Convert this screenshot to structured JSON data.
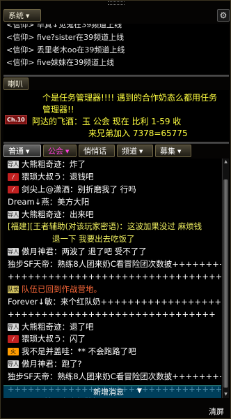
{
  "header": {
    "system_tab": "系统",
    "gear_icon": "gear-icon",
    "horn_tab": "喇叭"
  },
  "system_messages": [
    "<信仰>  毕真↓见鬼在39频道上线",
    "<信仰>  five?sister在39频道上线",
    "<信仰>  丢里老木oo在39频道上线",
    "<信仰>  five妹妹在39频道上线"
  ],
  "horn": {
    "line1": "个是任务管理器!!!!  遇到的合作奶态么都用任务",
    "line2": "管理器!!",
    "channel_badge": "Ch.10",
    "sender": "阿达的飞酒：玉   公会 现在   比利  1-59   收",
    "line4": "来兄弟加入    7378=65775"
  },
  "chat_tabs": [
    {
      "label": "普通",
      "color": "#ffffff"
    },
    {
      "label": "公会",
      "color": "#ff3fdc"
    },
    {
      "label": "悄悄话",
      "color": "#ffffff"
    },
    {
      "label": "频道",
      "color": "#ffffff"
    },
    {
      "label": "募集",
      "color": "#ffffff"
    }
  ],
  "chat_messages": [
    {
      "badge": "square",
      "badge_text": "导人",
      "text": "大熊粗奇迹：炸了",
      "color": "#ffffff"
    },
    {
      "badge": "slash",
      "badge_text": "/",
      "text": "猥琐大叔う：退钱吧",
      "color": "#ffffff"
    },
    {
      "badge": "slash",
      "badge_text": "/",
      "text": "剑尖上@潇洒：别折磨我了   行吗",
      "color": "#ffffff"
    },
    {
      "badge": "",
      "badge_text": "",
      "text": "Dream↓燕：美方大阳",
      "color": "#ffffff"
    },
    {
      "badge": "square",
      "badge_text": "导人",
      "text": "大熊粗奇迹：出来吧",
      "color": "#ffffff"
    },
    {
      "badge": "",
      "badge_text": "",
      "text": "[福建][王者辅助(对该玩家密语)：这波加果没过 麻烦钱",
      "color": "#f0f060"
    },
    {
      "badge": "",
      "badge_text": "",
      "text": "退一下 我要出去吃饭了",
      "color": "#f0f060",
      "indent": true
    },
    {
      "badge": "square",
      "badge_text": "导人",
      "text": "傲月神君：两波了   退了吧   受不了了",
      "color": "#ffffff"
    },
    {
      "badge": "",
      "badge_text": "",
      "text": "独步SF天帝：熟练8人团来奶C看冒险团次数披+++++++++",
      "color": "#ffffff"
    },
    {
      "badge": "",
      "badge_text": "",
      "text": "++++++++++++++++++++++++++++++++7=1来奶",
      "color": "#ffffff"
    },
    {
      "badge": "lead",
      "badge_text": "队长",
      "text": "队伍已回到作战营地。",
      "color": "#ff6a3a"
    },
    {
      "badge": "",
      "badge_text": "",
      "text": "Forever↓敏：来个红队奶++++++++++++++++++++++++",
      "color": "#ffffff"
    },
    {
      "badge": "",
      "badge_text": "",
      "text": "+++++++++++++++++++++++++++++++",
      "color": "#ffffff"
    },
    {
      "badge": "square",
      "badge_text": "导人",
      "text": "大熊粗奇迹：退了吧",
      "color": "#ffffff"
    },
    {
      "badge": "slash",
      "badge_text": "/",
      "text": "猥琐大叔う：闪了",
      "color": "#ffffff"
    },
    {
      "badge": "fire",
      "badge_text": "火",
      "text": "我不是并盖哇：** 不会跑路了吧",
      "color": "#ffffff"
    },
    {
      "badge": "square",
      "badge_text": "导人",
      "text": "傲月神君：跑了?",
      "color": "#ffffff"
    },
    {
      "badge": "",
      "badge_text": "",
      "text": "独步SF天帝：熟练8人团来奶C看冒险团次数披+++++++++",
      "color": "#ffffff"
    },
    {
      "badge": "",
      "badge_text": "",
      "text": "++++++++++++++++++++++++++++++++7=1来奶",
      "color": "#ffffff"
    },
    {
      "badge": "",
      "badge_text": "",
      "text": "Forever↓敏：来个红队奶++++++++++++++++++++++++",
      "color": "#ffffff"
    }
  ],
  "new_message_bar": {
    "label": "新增消息",
    "icon": "chevron-down-icon"
  },
  "clear_button": "清屏"
}
